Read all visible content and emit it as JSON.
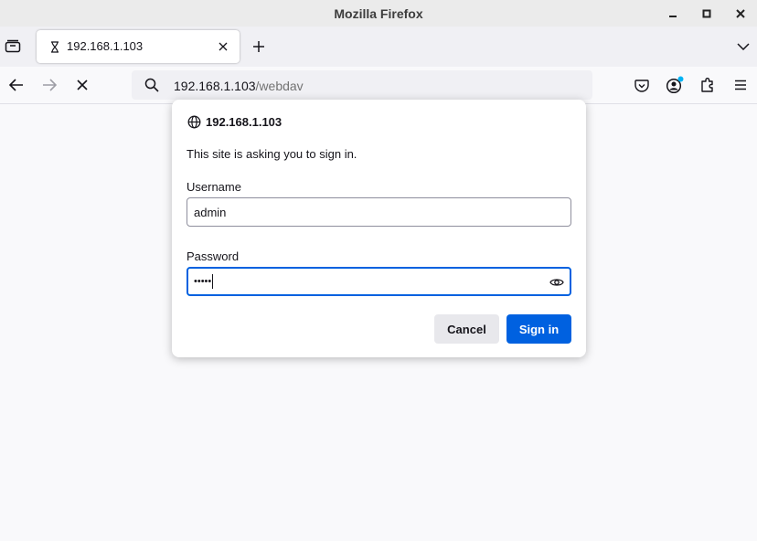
{
  "window": {
    "title": "Mozilla Firefox"
  },
  "tabs": [
    {
      "title": "192.168.1.103",
      "icon": "hourglass-icon"
    }
  ],
  "urlbar": {
    "host": "192.168.1.103",
    "path": "/webdav"
  },
  "auth_dialog": {
    "host": "192.168.1.103",
    "message": "This site is asking you to sign in.",
    "username_label": "Username",
    "username_value": "admin",
    "password_label": "Password",
    "password_masked": "•••••",
    "cancel_label": "Cancel",
    "signin_label": "Sign in"
  },
  "colors": {
    "accent": "#0061e0",
    "badge": "#00b3f4"
  }
}
